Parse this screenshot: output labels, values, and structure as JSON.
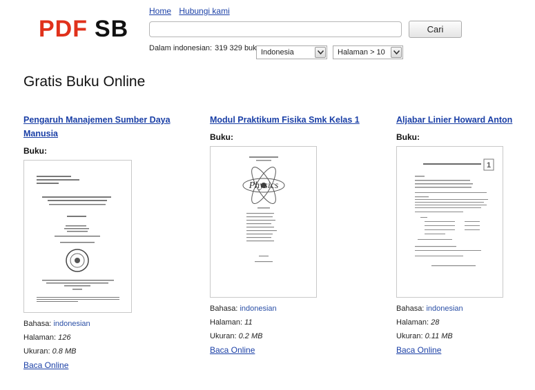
{
  "logo": {
    "part1": "PDF",
    "part2": "SB"
  },
  "nav": {
    "home": "Home",
    "contact": "Hubungi kami"
  },
  "search": {
    "value": "",
    "placeholder": "",
    "button_label": "Cari"
  },
  "stats": {
    "label": "Dalam indonesian:",
    "count": "319 329 buku"
  },
  "filters": {
    "language": "Indonesia",
    "pages": "Halaman > 10"
  },
  "page_title": "Gratis Buku Online",
  "labels": {
    "type": "Buku:",
    "language": "Bahasa:",
    "pages": "Halaman:",
    "size": "Ukuran:",
    "read": "Baca Online"
  },
  "books": [
    {
      "title": "Pengaruh Manajemen Sumber Daya Manusia",
      "language": "indonesian",
      "pages": "126",
      "size": "0.8 MB"
    },
    {
      "title": "Modul Praktikum Fisika Smk Kelas 1",
      "language": "indonesian",
      "pages": "11",
      "size": "0.2 MB",
      "thumb_text": "Physics"
    },
    {
      "title": "Aljabar Linier Howard Anton",
      "language": "indonesian",
      "pages": "28",
      "size": "0.11 MB",
      "thumb_number": "1"
    }
  ],
  "colors": {
    "logo_red": "#e0311b",
    "link_blue": "#1a3fa6"
  }
}
